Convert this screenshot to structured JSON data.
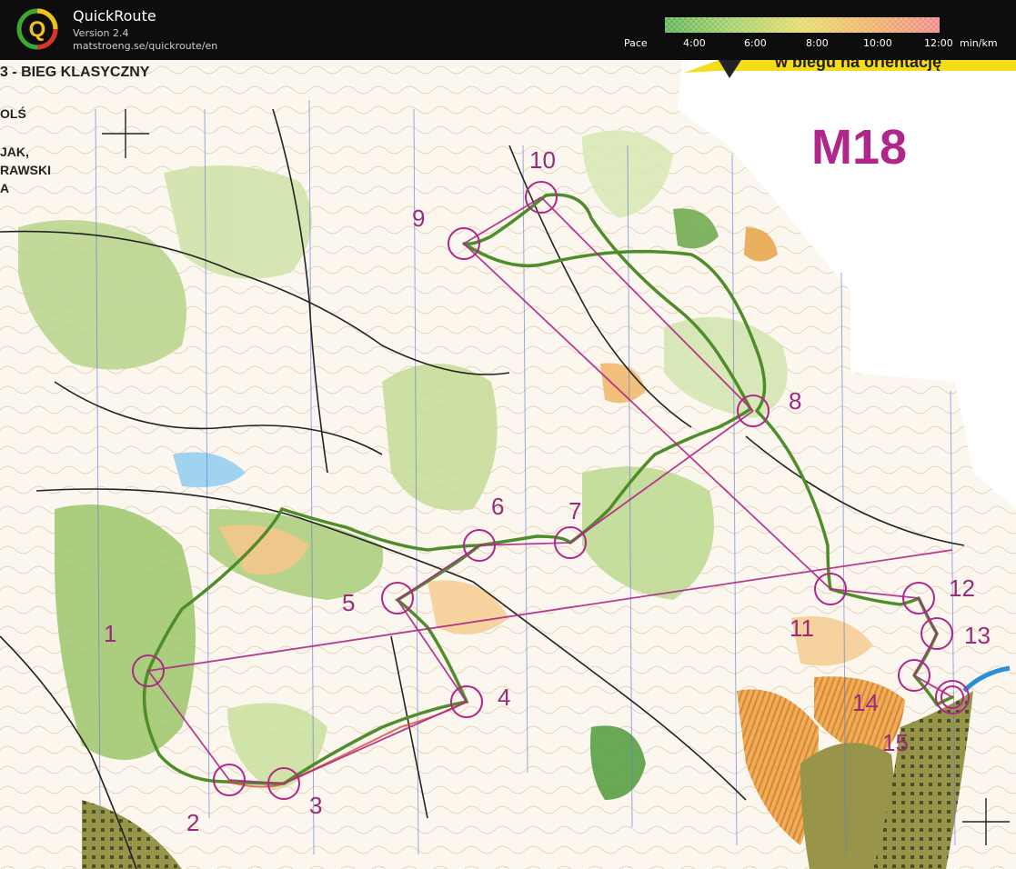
{
  "header": {
    "app_name": "QuickRoute",
    "version": "Version 2.4",
    "url": "matstroeng.se/quickroute/en",
    "logo_letter": "Q"
  },
  "pace_legend": {
    "label": "Pace",
    "unit": "min/km",
    "ticks": [
      "4:00",
      "6:00",
      "8:00",
      "10:00",
      "12:00"
    ],
    "colors": [
      "#64b45a",
      "#a8d26e",
      "#e6dc6e",
      "#f0b46e",
      "#f08c8c"
    ]
  },
  "map": {
    "class_label": "M18",
    "banner_text": "w biegu na orientację",
    "header_fragment": "3 - BIEG KLASYCZNY",
    "side_texts": [
      "OLŚ",
      "JAK,",
      "RAWSKI",
      "A"
    ],
    "course_color": "#b0268a",
    "route_color": "#4f8d2a",
    "controls": [
      {
        "label": "1"
      },
      {
        "label": "2"
      },
      {
        "label": "3"
      },
      {
        "label": "4"
      },
      {
        "label": "5"
      },
      {
        "label": "6"
      },
      {
        "label": "7"
      },
      {
        "label": "8"
      },
      {
        "label": "9"
      },
      {
        "label": "10"
      },
      {
        "label": "11"
      },
      {
        "label": "12"
      },
      {
        "label": "13"
      },
      {
        "label": "14"
      },
      {
        "label": "15"
      }
    ]
  }
}
